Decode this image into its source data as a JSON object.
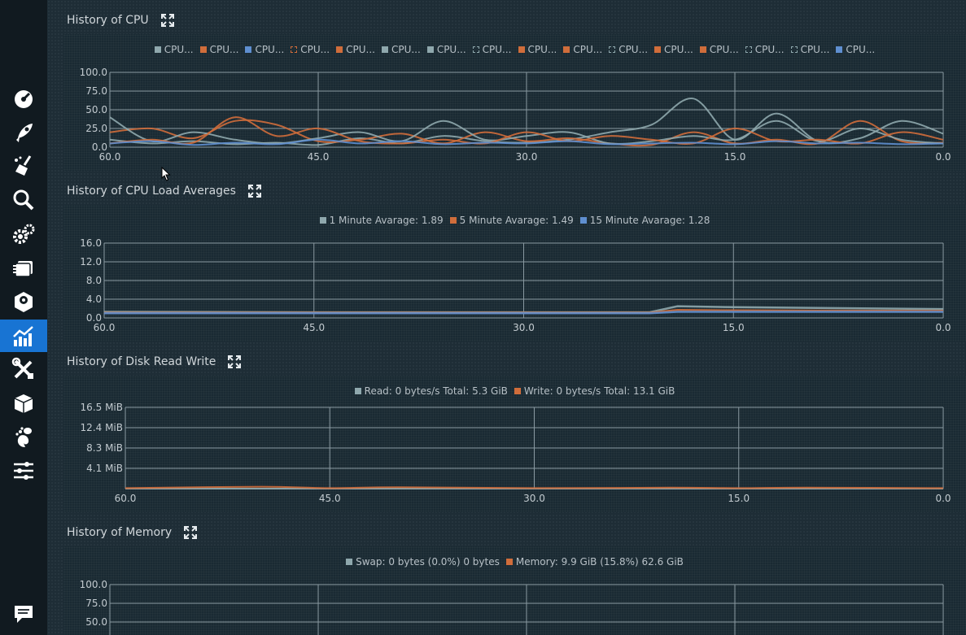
{
  "sidebar": {
    "items": [
      {
        "icon": "speedometer-icon",
        "active": false
      },
      {
        "icon": "rocket-icon",
        "active": false
      },
      {
        "icon": "broom-icon",
        "active": false
      },
      {
        "icon": "search-icon",
        "active": false
      },
      {
        "icon": "gears-icon",
        "active": false
      },
      {
        "icon": "stack-icon",
        "active": false
      },
      {
        "icon": "disk-icon",
        "active": false
      },
      {
        "icon": "chart-icon",
        "active": true
      },
      {
        "icon": "tools-icon",
        "active": false
      },
      {
        "icon": "package-icon",
        "active": false
      },
      {
        "icon": "gnome-icon",
        "active": false
      },
      {
        "icon": "sliders-icon",
        "active": false
      },
      {
        "icon": "comment-icon",
        "active": false
      }
    ]
  },
  "colors": {
    "teal": "#8fa8ad",
    "orange": "#d06d3b",
    "blue": "#5f8fd0",
    "accent": "#1874d3"
  },
  "sections": [
    {
      "title": "History of CPU",
      "chart_data": {
        "type": "line",
        "legend": [
          "CPU...",
          "CPU...",
          "CPU...",
          "CPU...",
          "CPU...",
          "CPU...",
          "CPU...",
          "CPU...",
          "CPU...",
          "CPU...",
          "CPU...",
          "CPU...",
          "CPU...",
          "CPU...",
          "CPU...",
          "CPU..."
        ],
        "legend_colors": [
          "#8fa8ad",
          "#d06d3b",
          "#5f8fd0",
          "#d06d3b",
          "#d06d3b",
          "#8fa8ad",
          "#8fa8ad",
          "#8fa8ad",
          "#d06d3b",
          "#d06d3b",
          "#8fa8ad",
          "#d06d3b",
          "#d06d3b",
          "#8fa8ad",
          "#8fa8ad",
          "#5f8fd0"
        ],
        "legend_dashed": [
          false,
          false,
          false,
          true,
          false,
          false,
          false,
          true,
          false,
          false,
          true,
          false,
          false,
          true,
          true,
          false
        ],
        "x_ticks": [
          "60.0",
          "45.0",
          "30.0",
          "15.0",
          "0.0"
        ],
        "y_ticks": [
          "100.0",
          "75.0",
          "50.0",
          "25.0",
          "0.0"
        ],
        "xlim": [
          60,
          0
        ],
        "ylim": [
          0,
          100
        ],
        "x": [
          60,
          57,
          54,
          51,
          48,
          45,
          42,
          39,
          36,
          33,
          30,
          27,
          24,
          21,
          18,
          15,
          12,
          9,
          6,
          3,
          0
        ],
        "series": [
          {
            "color": "#8fa8ad",
            "values": [
              10,
              5,
              8,
              4,
              6,
              3,
              12,
              5,
              15,
              8,
              6,
              10,
              20,
              30,
              65,
              10,
              45,
              8,
              12,
              35,
              18
            ]
          },
          {
            "color": "#d06d3b",
            "values": [
              20,
              25,
              12,
              35,
              30,
              8,
              10,
              18,
              5,
              20,
              8,
              12,
              5,
              3,
              20,
              5,
              10,
              5,
              35,
              8,
              6
            ]
          },
          {
            "color": "#8fa8ad",
            "values": [
              40,
              8,
              20,
              10,
              5,
              12,
              20,
              8,
              35,
              10,
              15,
              20,
              5,
              8,
              15,
              10,
              35,
              8,
              25,
              10,
              5
            ]
          },
          {
            "color": "#d06d3b",
            "values": [
              5,
              10,
              6,
              40,
              15,
              25,
              8,
              5,
              10,
              5,
              20,
              8,
              15,
              10,
              5,
              25,
              8,
              10,
              5,
              20,
              10
            ]
          },
          {
            "color": "#5f8fd0",
            "values": [
              5,
              8,
              3,
              6,
              4,
              10,
              5,
              8,
              4,
              6,
              5,
              8,
              4,
              5,
              6,
              4,
              8,
              5,
              6,
              4,
              5
            ]
          }
        ]
      }
    },
    {
      "title": "History of CPU Load Averages",
      "chart_data": {
        "type": "line",
        "legend": [
          "1 Minute Avarage: 1.89",
          "5 Minute Avarage: 1.49",
          "15 Minute Avarage: 1.28"
        ],
        "legend_colors": [
          "#8fa8ad",
          "#d06d3b",
          "#5f8fd0"
        ],
        "x_ticks": [
          "60.0",
          "45.0",
          "30.0",
          "15.0",
          "0.0"
        ],
        "y_ticks": [
          "16.0",
          "12.0",
          "8.0",
          "4.0",
          "0.0"
        ],
        "xlim": [
          60,
          0
        ],
        "ylim": [
          0,
          16
        ],
        "x": [
          60,
          45,
          30,
          21,
          19,
          15,
          0
        ],
        "series": [
          {
            "name": "1 Minute Avarage: 1.89",
            "color": "#8fa8ad",
            "values": [
              1.3,
              1.2,
              1.2,
              1.2,
              2.5,
              2.3,
              1.9
            ]
          },
          {
            "name": "5 Minute Avarage: 1.49",
            "color": "#d06d3b",
            "values": [
              1.1,
              1.1,
              1.1,
              1.1,
              1.7,
              1.6,
              1.5
            ]
          },
          {
            "name": "15 Minute Avarage: 1.28",
            "color": "#5f8fd0",
            "values": [
              1.0,
              1.0,
              1.0,
              1.0,
              1.3,
              1.3,
              1.3
            ]
          }
        ]
      }
    },
    {
      "title": "History of Disk Read Write",
      "chart_data": {
        "type": "line",
        "legend": [
          "Read: 0 bytes/s Total: 5.3 GiB",
          "Write: 0 bytes/s Total: 13.1 GiB"
        ],
        "legend_colors": [
          "#8fa8ad",
          "#d06d3b"
        ],
        "x_ticks": [
          "60.0",
          "45.0",
          "30.0",
          "15.0",
          "0.0"
        ],
        "y_ticks": [
          "16.5 MiB",
          "12.4 MiB",
          "8.3 MiB",
          "4.1 MiB",
          ""
        ],
        "xlim": [
          60,
          0
        ],
        "ylim": [
          0,
          16.5
        ],
        "x": [
          60,
          50,
          45,
          40,
          30,
          20,
          15,
          10,
          0
        ],
        "series": [
          {
            "name": "Read: 0 bytes/s Total: 5.3 GiB",
            "color": "#8fa8ad",
            "values": [
              0,
              0,
              0,
              0,
              0,
              0,
              0,
              0,
              0
            ]
          },
          {
            "name": "Write: 0 bytes/s Total: 13.1 GiB",
            "color": "#d06d3b",
            "values": [
              0.1,
              0.4,
              0.1,
              0.3,
              0.1,
              0.2,
              0.1,
              0.2,
              0.1
            ]
          }
        ]
      }
    },
    {
      "title": "History of Memory",
      "chart_data": {
        "type": "line",
        "legend": [
          "Swap: 0 bytes (0.0%) 0 bytes",
          "Memory: 9.9 GiB (15.8%) 62.6 GiB"
        ],
        "legend_colors": [
          "#8fa8ad",
          "#d06d3b"
        ],
        "x_ticks": [],
        "y_ticks": [
          "100.0",
          "75.0",
          "50.0"
        ],
        "xlim": [
          60,
          0
        ],
        "ylim": [
          50,
          100
        ],
        "x": [],
        "series": []
      }
    }
  ]
}
